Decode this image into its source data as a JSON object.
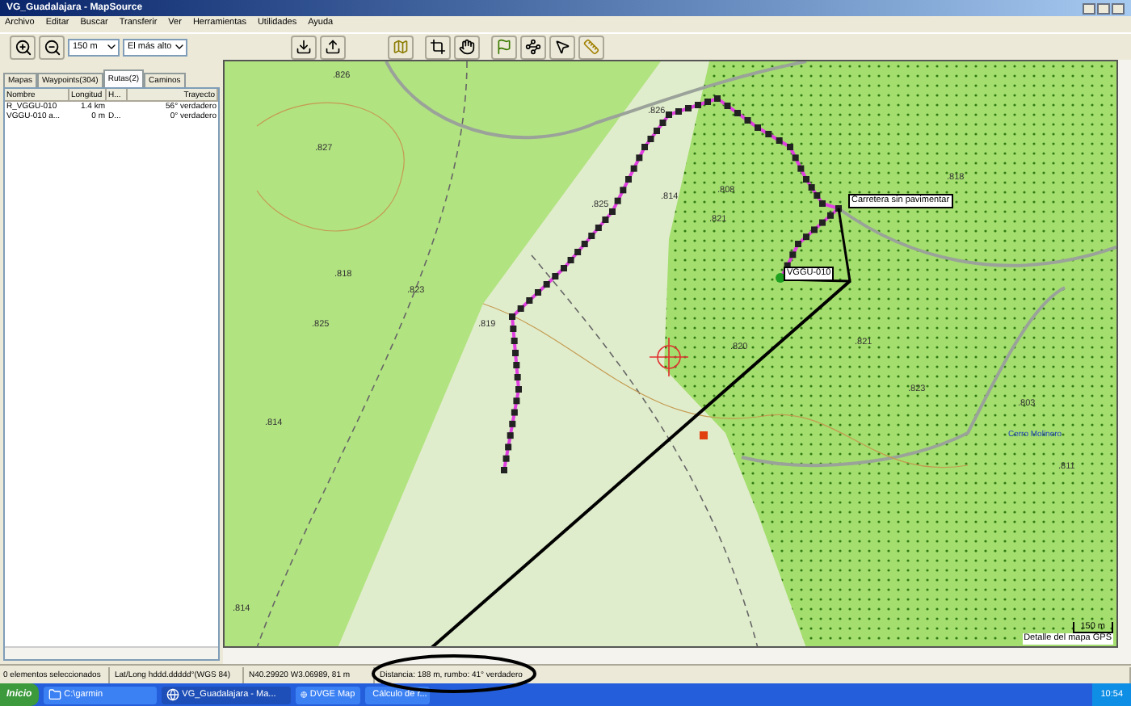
{
  "window": {
    "title": "VG_Guadalajara - MapSource"
  },
  "menu": [
    "Archivo",
    "Editar",
    "Buscar",
    "Transferir",
    "Ver",
    "Herramientas",
    "Utilidades",
    "Ayuda"
  ],
  "toolbar": {
    "zoom_scale": "150 m",
    "detail": "El más alto"
  },
  "tabs": [
    {
      "label": "Mapas",
      "selected": false
    },
    {
      "label": "Waypoints(304)",
      "selected": false
    },
    {
      "label": "Rutas(2)",
      "selected": true
    },
    {
      "label": "Caminos",
      "selected": false
    }
  ],
  "table": {
    "columns": [
      "Nombre",
      "Longitud",
      "H...",
      "Trayecto"
    ],
    "rows": [
      {
        "cells": [
          "R_VGGU-010",
          "1.4 km",
          "",
          "56° verdadero"
        ]
      },
      {
        "cells": [
          "VGGU-010 a...",
          "0 m",
          "D...",
          "0° verdadero"
        ]
      }
    ]
  },
  "map": {
    "elevations": [
      ".826",
      ".827",
      ".826",
      ".814",
      ".825",
      ".818",
      ".823",
      ".825",
      ".819",
      ".808",
      ".818",
      ".821",
      ".820",
      ".821",
      ".823",
      ".814",
      ".803",
      ".811",
      ".814"
    ],
    "place_label": "Cerro Molinero",
    "road_tooltip": "Carretera sin pavimentar",
    "waypoint_label": "VGGU-010",
    "scale": "150 m",
    "detail_label": "Detalle del mapa GPS"
  },
  "status_bar": [
    "0 elementos seleccionados",
    "Lat/Long hddd.ddddd°(WGS 84)",
    "N40.29920 W3.06989, 81 m",
    "Distancia: 188 m, rumbo: 41° verdadero"
  ],
  "taskbar": {
    "start": "Inicio",
    "items": [
      "C:\\garmin",
      "VG_Guadalajara - Ma...",
      "DVGE Map",
      "Cálculo de r..."
    ],
    "clock": "10:54"
  }
}
